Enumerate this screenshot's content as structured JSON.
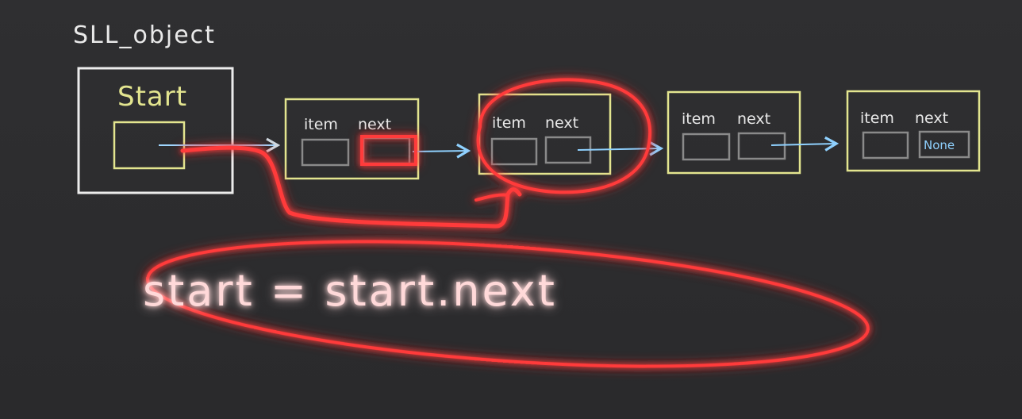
{
  "diagram": {
    "object_label": "SLL_object",
    "start_label": "Start",
    "nodes": [
      {
        "item_label": "item",
        "next_label": "next",
        "next_value": ""
      },
      {
        "item_label": "item",
        "next_label": "next",
        "next_value": ""
      },
      {
        "item_label": "item",
        "next_label": "next",
        "next_value": ""
      },
      {
        "item_label": "item",
        "next_label": "next",
        "next_value": "None"
      }
    ],
    "annotation": "start = start.next",
    "colors": {
      "background": "#2d2d2f",
      "object_border": "#ececec",
      "node_border": "#e3e58f",
      "cell_border": "#8a8a8a",
      "pointer_arrow": "#8fd1ff",
      "highlight": "#ff2a2a"
    }
  }
}
